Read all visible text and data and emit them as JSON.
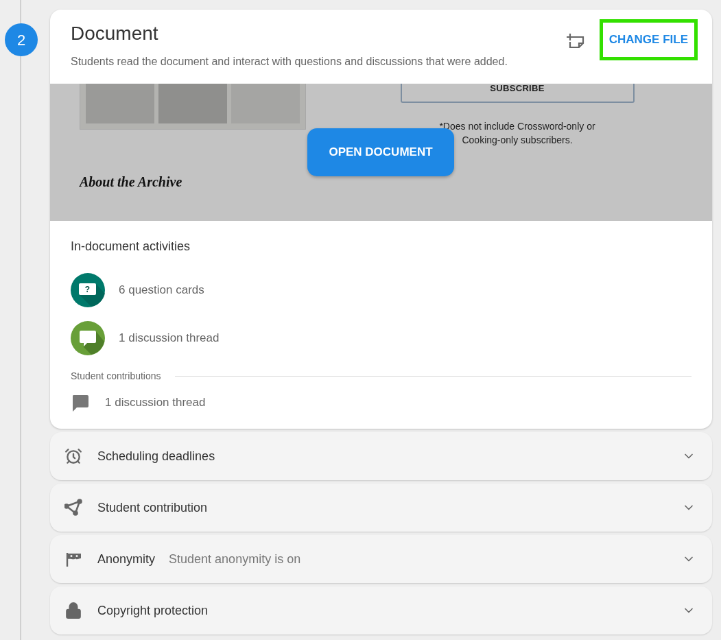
{
  "step": {
    "number": "2"
  },
  "document": {
    "title": "Document",
    "description": "Students read the document and interact with questions and discussions that were added.",
    "change_file": "CHANGE FILE",
    "open_button": "OPEN DOCUMENT",
    "preview": {
      "subscribe": "SUBSCRIBE",
      "note": "*Does not include Crossword-only or Cooking-only subscribers.",
      "heading": "About the Archive"
    }
  },
  "activities": {
    "title": "In-document activities",
    "items": [
      {
        "kind": "question",
        "glyph": "?",
        "label": "6 question cards"
      },
      {
        "kind": "discussion",
        "label": "1 discussion thread"
      }
    ]
  },
  "student_contributions": {
    "title": "Student contributions",
    "items": [
      {
        "kind": "discussion",
        "label": "1 discussion thread"
      }
    ]
  },
  "sections": [
    {
      "kind": "schedule",
      "title": "Scheduling deadlines"
    },
    {
      "kind": "contribution",
      "title": "Student contribution"
    },
    {
      "kind": "anonymity",
      "title": "Anonymity",
      "summary": "Student anonymity is on"
    },
    {
      "kind": "copyright",
      "title": "Copyright protection"
    }
  ]
}
